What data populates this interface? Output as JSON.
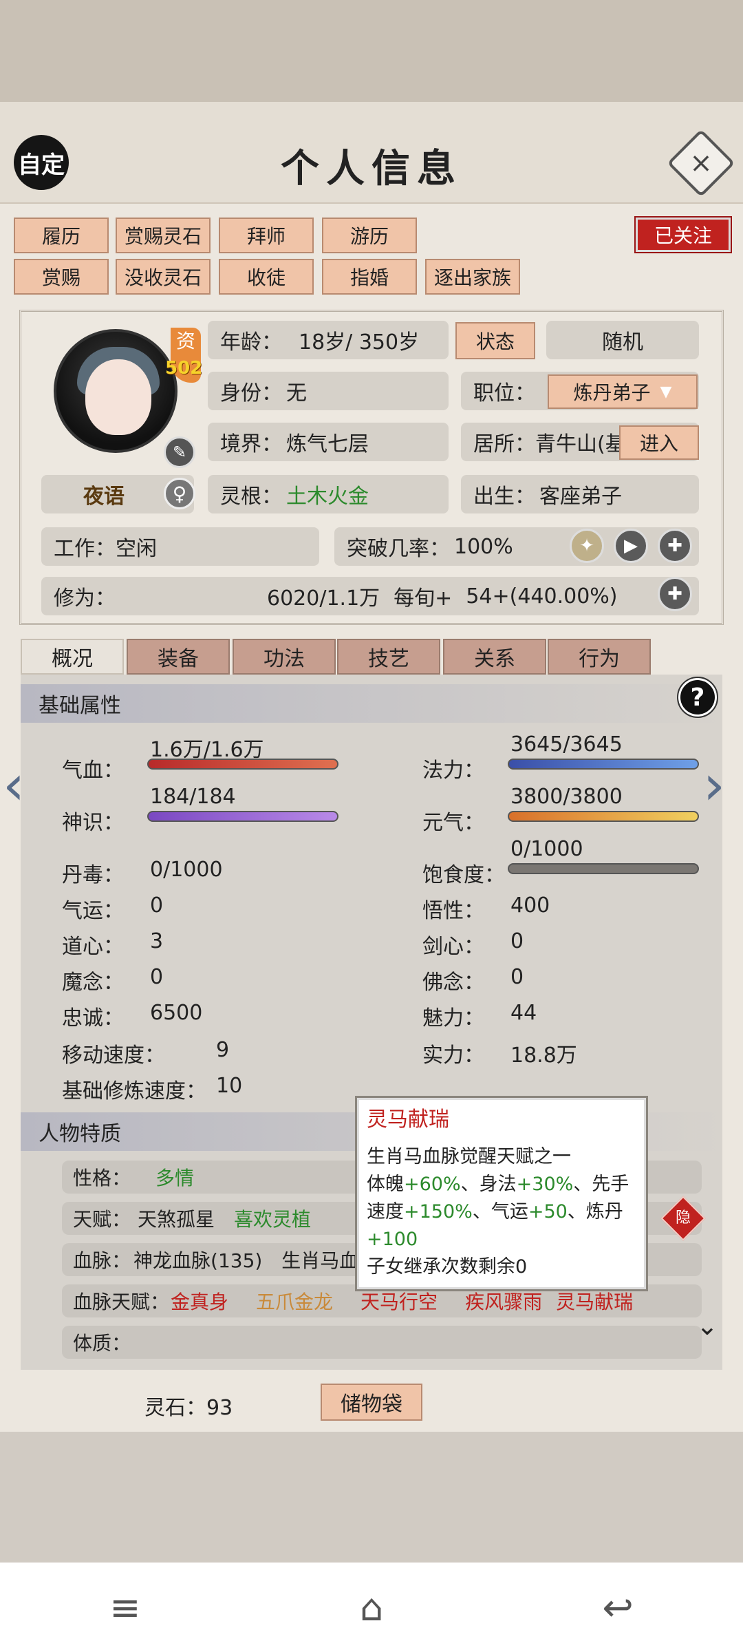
{
  "header": {
    "title": "个人信息",
    "custom": "自定",
    "close": "×"
  },
  "actions": [
    "履历",
    "赏赐灵石",
    "拜师",
    "游历",
    "赏赐",
    "没收灵石",
    "收徒",
    "指婚",
    "逐出家族"
  ],
  "follow": "已关注",
  "profile": {
    "zi": "资",
    "zi_value": "502",
    "name": "夜语",
    "gender": "♀",
    "age_label": "年龄：",
    "age": "18岁/ 350岁",
    "status_btn": "状态",
    "random_btn": "随机",
    "identity_label": "身份：",
    "identity": "无",
    "post_label": "职位：",
    "post": "炼丹弟子",
    "realm_label": "境界：",
    "realm": "炼气七层",
    "residence_label": "居所：",
    "residence": "青牛山(基",
    "enter_btn": "进入",
    "root_label": "灵根：",
    "root": "土木火金",
    "birth_label": "出生：",
    "birth": "客座弟子",
    "work": "工作：空闲",
    "breakthrough_label": "突破几率：",
    "breakthrough": "100%",
    "cultivation_label": "修为：",
    "cultivation": "6020/1.1万",
    "per_turn_label": "每旬+",
    "per_turn": "54+(440.00%)"
  },
  "tabs": [
    "概况",
    "装备",
    "功法",
    "技艺",
    "关系",
    "行为"
  ],
  "basic": {
    "title": "基础属性",
    "qixue_label": "气血：",
    "qixue": "1.6万/1.6万",
    "qixue_fill": 1.0,
    "fali_label": "法力：",
    "fali": "3645/3645",
    "fali_fill": 1.0,
    "shenshi_label": "神识：",
    "shenshi": "184/184",
    "shenshi_fill": 1.0,
    "yuanqi_label": "元气：",
    "yuanqi": "3800/3800",
    "yuanqi_fill": 1.0,
    "baoshi_label": "饱食度：",
    "baoshi": "0/1000",
    "baoshi_fill": 0.0,
    "stats": [
      {
        "l": "丹毒：",
        "v": "0/1000"
      },
      {
        "l": "气运：",
        "v": "0"
      },
      {
        "l": "道心：",
        "v": "3"
      },
      {
        "l": "魔念：",
        "v": "0"
      },
      {
        "l": "忠诚：",
        "v": "6500"
      },
      {
        "l": "移动速度：",
        "v": "9"
      },
      {
        "l": "基础修炼速度：",
        "v": "10"
      }
    ],
    "stats_r": [
      {
        "l": "悟性：",
        "v": "400"
      },
      {
        "l": "剑心：",
        "v": "0"
      },
      {
        "l": "佛念：",
        "v": "0"
      },
      {
        "l": "魅力：",
        "v": "44"
      },
      {
        "l": "实力：",
        "v": "18.8万"
      }
    ]
  },
  "traits": {
    "title": "人物特质",
    "personality_label": "性格：",
    "personality": "多情",
    "talent_label": "天赋：",
    "talent1": "天煞孤星",
    "talent2": "喜欢灵植",
    "hide": "隐",
    "blood_label": "血脉：",
    "blood": "神龙血脉(135)　生肖马血",
    "blood_talent_label": "血脉天赋：",
    "bt1": "金真身",
    "bt2": "五爪金龙",
    "bt3": "天马行空",
    "bt4": "疾风骤雨",
    "bt5": "灵马献瑞",
    "physique_label": "体质："
  },
  "tooltip": {
    "title": "灵马献瑞",
    "line1": "生肖马血脉觉醒天赋之一",
    "line2a": "体魄",
    "line2b": "+60%",
    "line2c": "、身法",
    "line2d": "+30%",
    "line2e": "、先手",
    "line3a": "速度",
    "line3b": "+150%",
    "line3c": "、气运",
    "line3d": "+50",
    "line3e": "、炼丹",
    "line4": "+100",
    "line5": "子女继承次数剩余0"
  },
  "footer": {
    "lingshi": "灵石：93",
    "storage": "储物袋"
  },
  "colors": {
    "accent": "#c0221f",
    "green": "#2c8a2c",
    "button": "#f0c4a8"
  }
}
